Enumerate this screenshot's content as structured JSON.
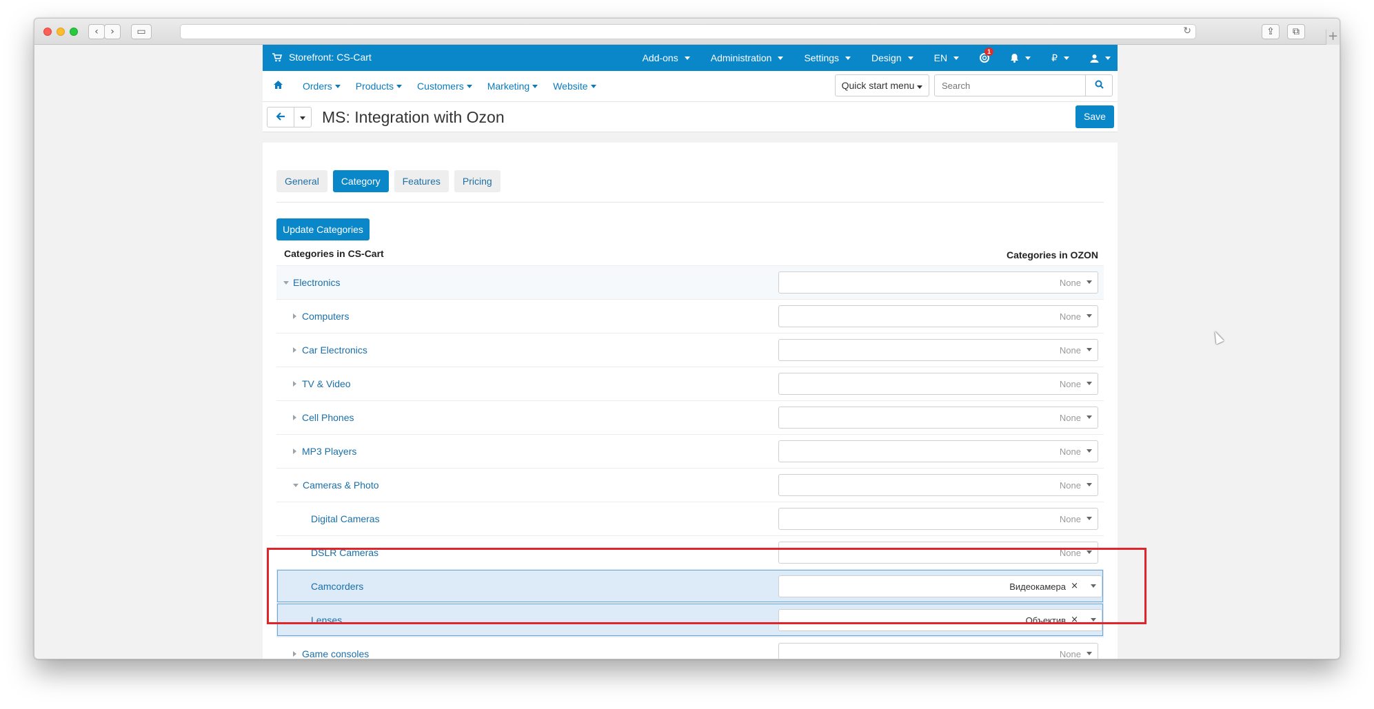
{
  "browser": {
    "back_glyph": "‹",
    "forward_glyph": "›",
    "sidebar_glyph": "▭",
    "reload_glyph": "↻",
    "share_glyph": "⇪",
    "tabs_glyph": "⧉",
    "plus_glyph": "+"
  },
  "topbar": {
    "store_label": "Storefront: CS-Cart",
    "items": [
      "Add-ons",
      "Administration",
      "Settings",
      "Design",
      "EN"
    ],
    "notif_count": "1",
    "currency": "₽"
  },
  "secondary_nav": {
    "items": [
      "Orders",
      "Products",
      "Customers",
      "Marketing",
      "Website"
    ],
    "quick_start": "Quick start menu",
    "search_placeholder": "Search"
  },
  "page": {
    "title": "MS: Integration with Ozon",
    "save_label": "Save"
  },
  "tabs": [
    "General",
    "Category",
    "Features",
    "Pricing"
  ],
  "update_button": "Update Categories",
  "columns": {
    "left": "Categories in CS-Cart",
    "right": "Categories in OZON"
  },
  "rows": [
    {
      "label": "Electronics",
      "value": "None"
    },
    {
      "label": "Computers",
      "value": "None"
    },
    {
      "label": "Car Electronics",
      "value": "None"
    },
    {
      "label": "TV & Video",
      "value": "None"
    },
    {
      "label": "Cell Phones",
      "value": "None"
    },
    {
      "label": "MP3 Players",
      "value": "None"
    },
    {
      "label": "Cameras & Photo",
      "value": "None"
    },
    {
      "label": "Digital Cameras",
      "value": "None"
    },
    {
      "label": "DSLR Cameras",
      "value": "None"
    },
    {
      "label": "Camcorders",
      "value": "Видеокамера",
      "clear": "×"
    },
    {
      "label": "Lenses",
      "value": "Объектив",
      "clear": "×"
    },
    {
      "label": "Game consoles",
      "value": "None"
    }
  ],
  "colors": {
    "primary": "#0a87c9",
    "link": "#1a6fa8",
    "highlight": "#dcebf7",
    "annotation": "#e0242a"
  }
}
